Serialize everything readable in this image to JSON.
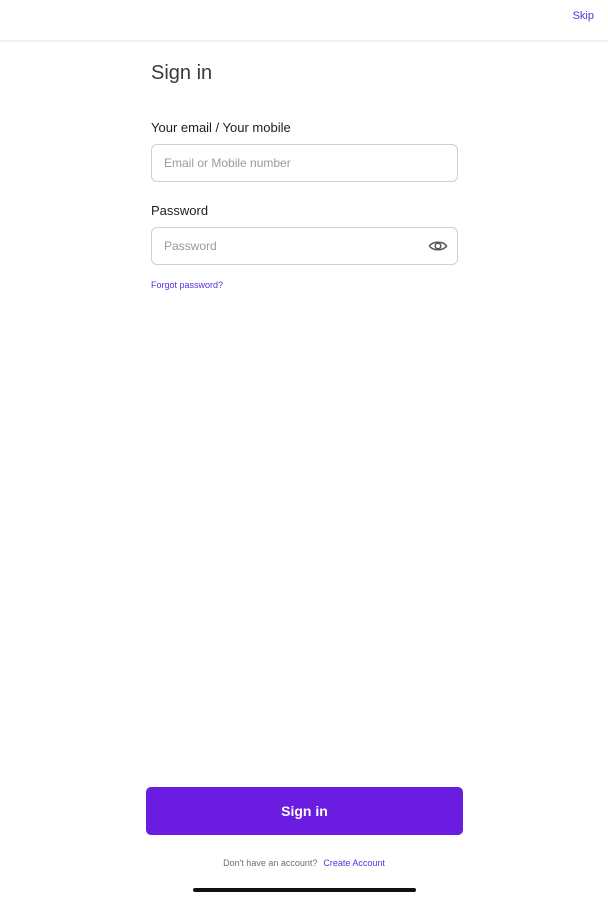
{
  "header": {
    "skip_label": "Skip"
  },
  "form": {
    "title": "Sign in",
    "email_label": "Your email / Your mobile",
    "email_placeholder": "Email or Mobile number",
    "email_value": "",
    "password_label": "Password",
    "password_placeholder": "Password",
    "password_value": "",
    "password_visibility_icon": "eye-icon",
    "forgot_label": "Forgot password?"
  },
  "actions": {
    "signin_label": "Sign in"
  },
  "footer": {
    "question": "Don't have an account?",
    "create_label": "Create Account"
  },
  "colors": {
    "accent": "#6a1de1",
    "link": "#5b2ee0"
  }
}
